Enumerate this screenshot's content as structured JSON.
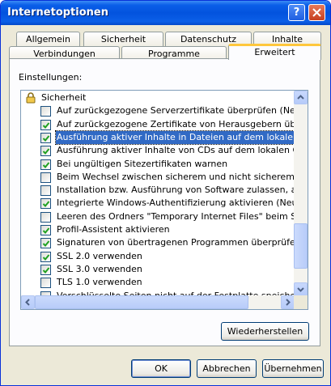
{
  "window": {
    "title": "Internetoptionen",
    "help_glyph": "?"
  },
  "tabs_row1": [
    "Allgemein",
    "Sicherheit",
    "Datenschutz",
    "Inhalte"
  ],
  "tabs_row2": [
    "Verbindungen",
    "Programme",
    "Erweitert"
  ],
  "active_tab": "Erweitert",
  "settings_label": "Einstellungen:",
  "list": {
    "group": "Sicherheit",
    "items": [
      {
        "label": "Auf zurückgezogene Serverzertifikate überprüfen (Neustart erf",
        "checked": false
      },
      {
        "label": "Auf zurückgezogene Zertifikate von Herausgebern überprüfen",
        "checked": true
      },
      {
        "label": "Ausführung aktiver Inhalte in Dateien auf dem lokalen Comput",
        "checked": true,
        "selected": true
      },
      {
        "label": "Ausführung aktiver Inhalte von CDs auf dem lokalen Computer",
        "checked": true
      },
      {
        "label": "Bei ungültigen Sitezertifikaten warnen",
        "checked": true
      },
      {
        "label": "Beim Wechsel zwischen sicherem und nicht sicherem Modus w",
        "checked": false
      },
      {
        "label": "Installation bzw. Ausführung von Software zulassen, auch wer",
        "checked": false
      },
      {
        "label": "Integrierte Windows-Authentifizierung aktivieren (Neustart erfor",
        "checked": true
      },
      {
        "label": "Leeren des Ordners \"Temporary Internet Files\" beim Schließer",
        "checked": false
      },
      {
        "label": "Profil-Assistent aktivieren",
        "checked": true
      },
      {
        "label": "Signaturen von übertragenen Programmen überprüfen",
        "checked": true
      },
      {
        "label": "SSL 2.0 verwenden",
        "checked": true
      },
      {
        "label": "SSL 3.0 verwenden",
        "checked": true
      },
      {
        "label": "TLS 1.0 verwenden",
        "checked": false
      },
      {
        "label": "Verschlüsselte Seiten nicht auf der Festplatte speichern",
        "checked": false
      }
    ]
  },
  "buttons": {
    "restore": "Wiederherstellen",
    "ok": "OK",
    "cancel": "Abbrechen",
    "apply": "Übernehmen"
  },
  "colors": {
    "accent": "#0353de",
    "selection": "#316ac5",
    "check": "#21a121"
  }
}
